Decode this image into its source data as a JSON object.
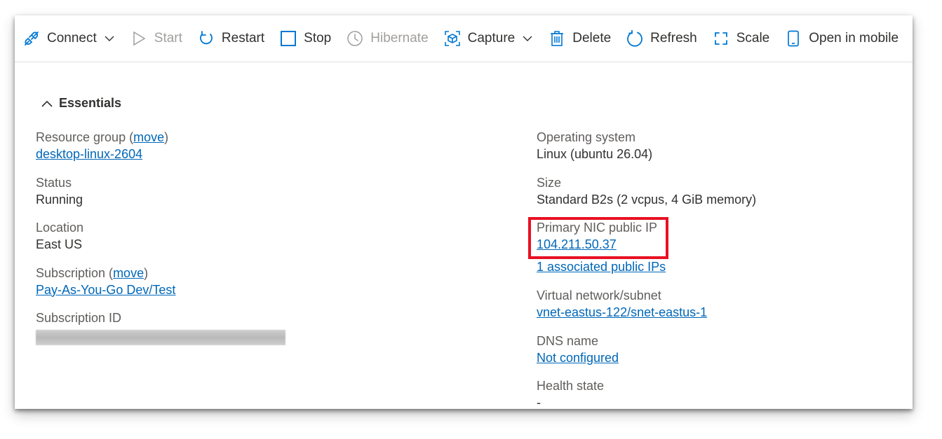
{
  "toolbar": {
    "connect": {
      "label": "Connect",
      "icon": "plug-icon"
    },
    "start": {
      "label": "Start",
      "icon": "play-icon"
    },
    "restart": {
      "label": "Restart",
      "icon": "restart-icon"
    },
    "stop": {
      "label": "Stop",
      "icon": "stop-icon"
    },
    "hibernate": {
      "label": "Hibernate",
      "icon": "clock-icon"
    },
    "capture": {
      "label": "Capture",
      "icon": "capture-icon"
    },
    "delete": {
      "label": "Delete",
      "icon": "trash-icon"
    },
    "refresh": {
      "label": "Refresh",
      "icon": "refresh-icon"
    },
    "scale": {
      "label": "Scale",
      "icon": "scale-icon"
    },
    "open_mobile": {
      "label": "Open in mobile",
      "icon": "mobile-icon"
    }
  },
  "essentials": {
    "header": "Essentials",
    "left": {
      "resource_group": {
        "label": "Resource group (",
        "move": "move",
        "close": ")",
        "value": "desktop-linux-2604"
      },
      "status": {
        "label": "Status",
        "value": "Running"
      },
      "location": {
        "label": "Location",
        "value": "East US"
      },
      "subscription": {
        "label": "Subscription (",
        "move": "move",
        "close": ")",
        "value": "Pay-As-You-Go Dev/Test"
      },
      "subscription_id": {
        "label": "Subscription ID"
      }
    },
    "right": {
      "os": {
        "label": "Operating system",
        "value": "Linux (ubuntu 26.04)"
      },
      "size": {
        "label": "Size",
        "value": "Standard B2s (2 vcpus, 4 GiB memory)"
      },
      "public_ip": {
        "label": "Primary NIC public IP",
        "value": "104.211.50.37",
        "extra": "1 associated public IPs"
      },
      "vnet": {
        "label": "Virtual network/subnet",
        "value": "vnet-eastus-122/snet-eastus-1"
      },
      "dns": {
        "label": "DNS name",
        "value": "Not configured"
      },
      "health": {
        "label": "Health state",
        "value": "-"
      }
    }
  },
  "colors": {
    "accent": "#0067b8",
    "highlight": "#e81123",
    "disabled": "#a19f9d",
    "text": "#323130",
    "label": "#605e5c"
  }
}
